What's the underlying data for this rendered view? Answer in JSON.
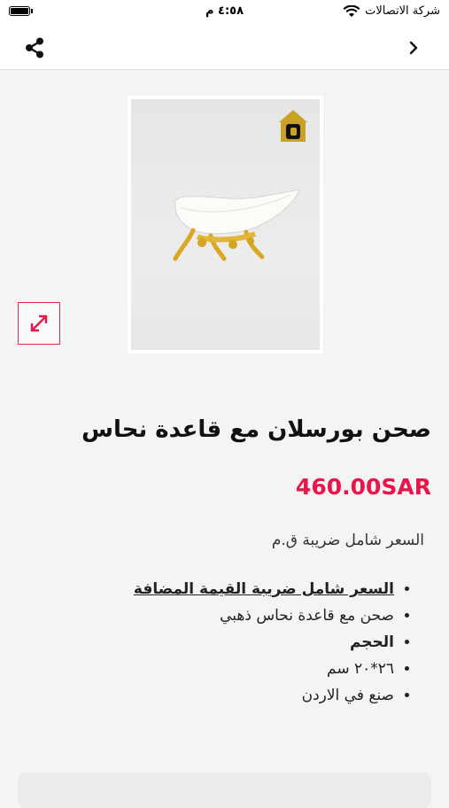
{
  "status_bar": {
    "carrier": "شركة الاتصالات",
    "time": "٤:٥٨ م",
    "battery_level": 1.0
  },
  "nav": {
    "share_icon": "share-icon",
    "back_icon": "chevron-right-icon"
  },
  "product": {
    "title": "صحن بورسلان مع قاعدة نحاس",
    "price": "460.00SAR",
    "tax_note": "السعر شامل ضريبة ق.م",
    "details": [
      "السعر شامل ضريبة القيمة المضافة",
      "صحن مع قاعدة نحاس ذهبي",
      "الحجم",
      "٢٦*٢٠ سم",
      "صنع في الاردن"
    ]
  },
  "colors": {
    "accent": "#e8164a"
  }
}
